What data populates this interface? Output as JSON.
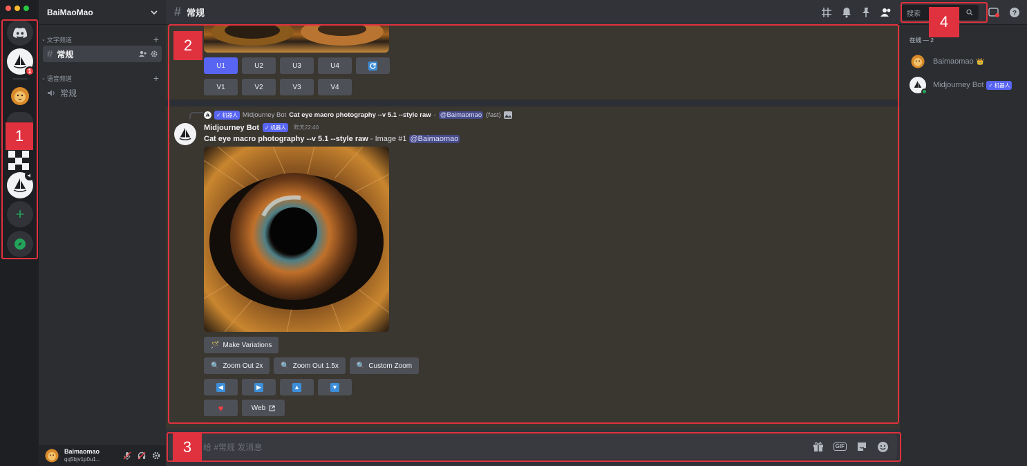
{
  "server": {
    "name": "BaiMaoMao"
  },
  "rail": {
    "notification_count": "1"
  },
  "categories": [
    {
      "label": "文字频道",
      "channels": [
        {
          "name": "常规"
        }
      ]
    },
    {
      "label": "语音频道",
      "channels": [
        {
          "name": "常规"
        }
      ]
    }
  ],
  "user": {
    "name": "Baimaomao",
    "tag": "qq5bjv1p0u1..."
  },
  "channel": {
    "name": "常规"
  },
  "search": {
    "placeholder": "搜索"
  },
  "upper_buttons": {
    "row1": [
      "U1",
      "U2",
      "U3",
      "U4"
    ],
    "row2": [
      "V1",
      "V2",
      "V3",
      "V4"
    ]
  },
  "reply": {
    "badge": "✓ 机器人",
    "author": "Midjourney Bot",
    "prompt": "Cat eye macro photography --v 5.1 --style raw",
    "sep": "-",
    "mention": "@Baimaomao",
    "mode": "(fast)"
  },
  "message": {
    "author": "Midjourney Bot",
    "badge": "✓ 机器人",
    "time": "昨天22:40",
    "prompt": "Cat eye macro photography --v 5.1 --style raw",
    "suffix": " - Image #1 ",
    "mention": "@Baimaomao"
  },
  "actions": {
    "make_variations": "Make Variations",
    "zoom_out_2x": "Zoom Out 2x",
    "zoom_out_15x": "Zoom Out 1.5x",
    "custom_zoom": "Custom Zoom",
    "web": "Web"
  },
  "composer": {
    "placeholder": "给 #常规 发消息"
  },
  "members": {
    "header": "在线 — 2",
    "list": [
      {
        "name": "Baimaomao",
        "crown": "👑"
      },
      {
        "name": "Midjourney Bot",
        "badge": "✓ 机器人"
      }
    ]
  },
  "annotations": [
    "1",
    "2",
    "3",
    "4"
  ],
  "colors": {
    "blurple": "#5865f2",
    "annotation_red": "#e0323e",
    "online": "#23a559"
  }
}
